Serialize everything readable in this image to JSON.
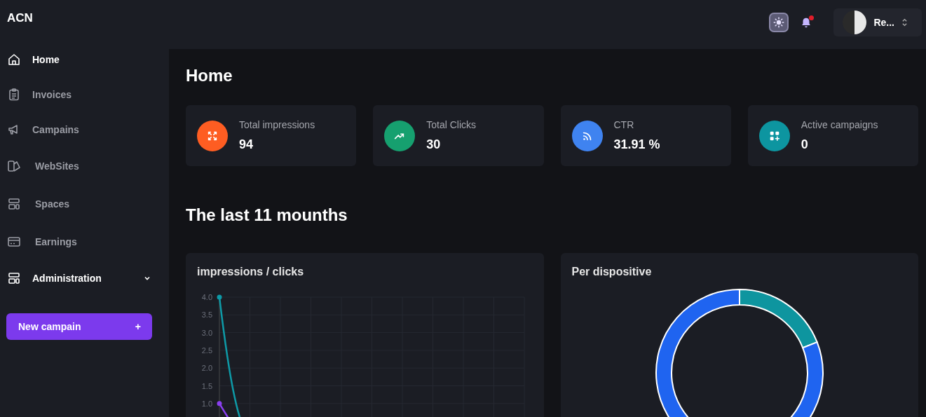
{
  "brand": "ACN",
  "topbar": {
    "notifications": {
      "unread": true
    },
    "user": {
      "name": "Re..."
    }
  },
  "sidebar": {
    "items": [
      {
        "label": "Home",
        "selected": true
      },
      {
        "label": "Invoices",
        "selected": false
      },
      {
        "label": "Campains",
        "selected": false
      },
      {
        "label": "WebSites",
        "selected": false
      },
      {
        "label": "Spaces",
        "selected": false
      },
      {
        "label": "Earnings",
        "selected": false
      }
    ],
    "group": {
      "label": "Administration",
      "expanded": false
    },
    "new_button": {
      "label": "New campain",
      "icon": "+"
    }
  },
  "page": {
    "title": "Home",
    "stats": [
      {
        "label": "Total impressions",
        "value": "94",
        "color": "#fe5d22"
      },
      {
        "label": "Total Clicks",
        "value": "30",
        "color": "#16a06f"
      },
      {
        "label": "CTR",
        "value": "31.91 %",
        "color": "#3f83f0"
      },
      {
        "label": "Active campaigns",
        "value": "0",
        "color": "#0d95a0"
      }
    ],
    "section_title": "The last 11 mounths",
    "line_card": {
      "title": "impressions / clicks",
      "y_axis_labels": [
        "4.0",
        "3.5",
        "3.0",
        "2.5",
        "2.0",
        "1.5",
        "1.0"
      ]
    },
    "donut_card": {
      "title": "Per dispositive"
    }
  }
}
